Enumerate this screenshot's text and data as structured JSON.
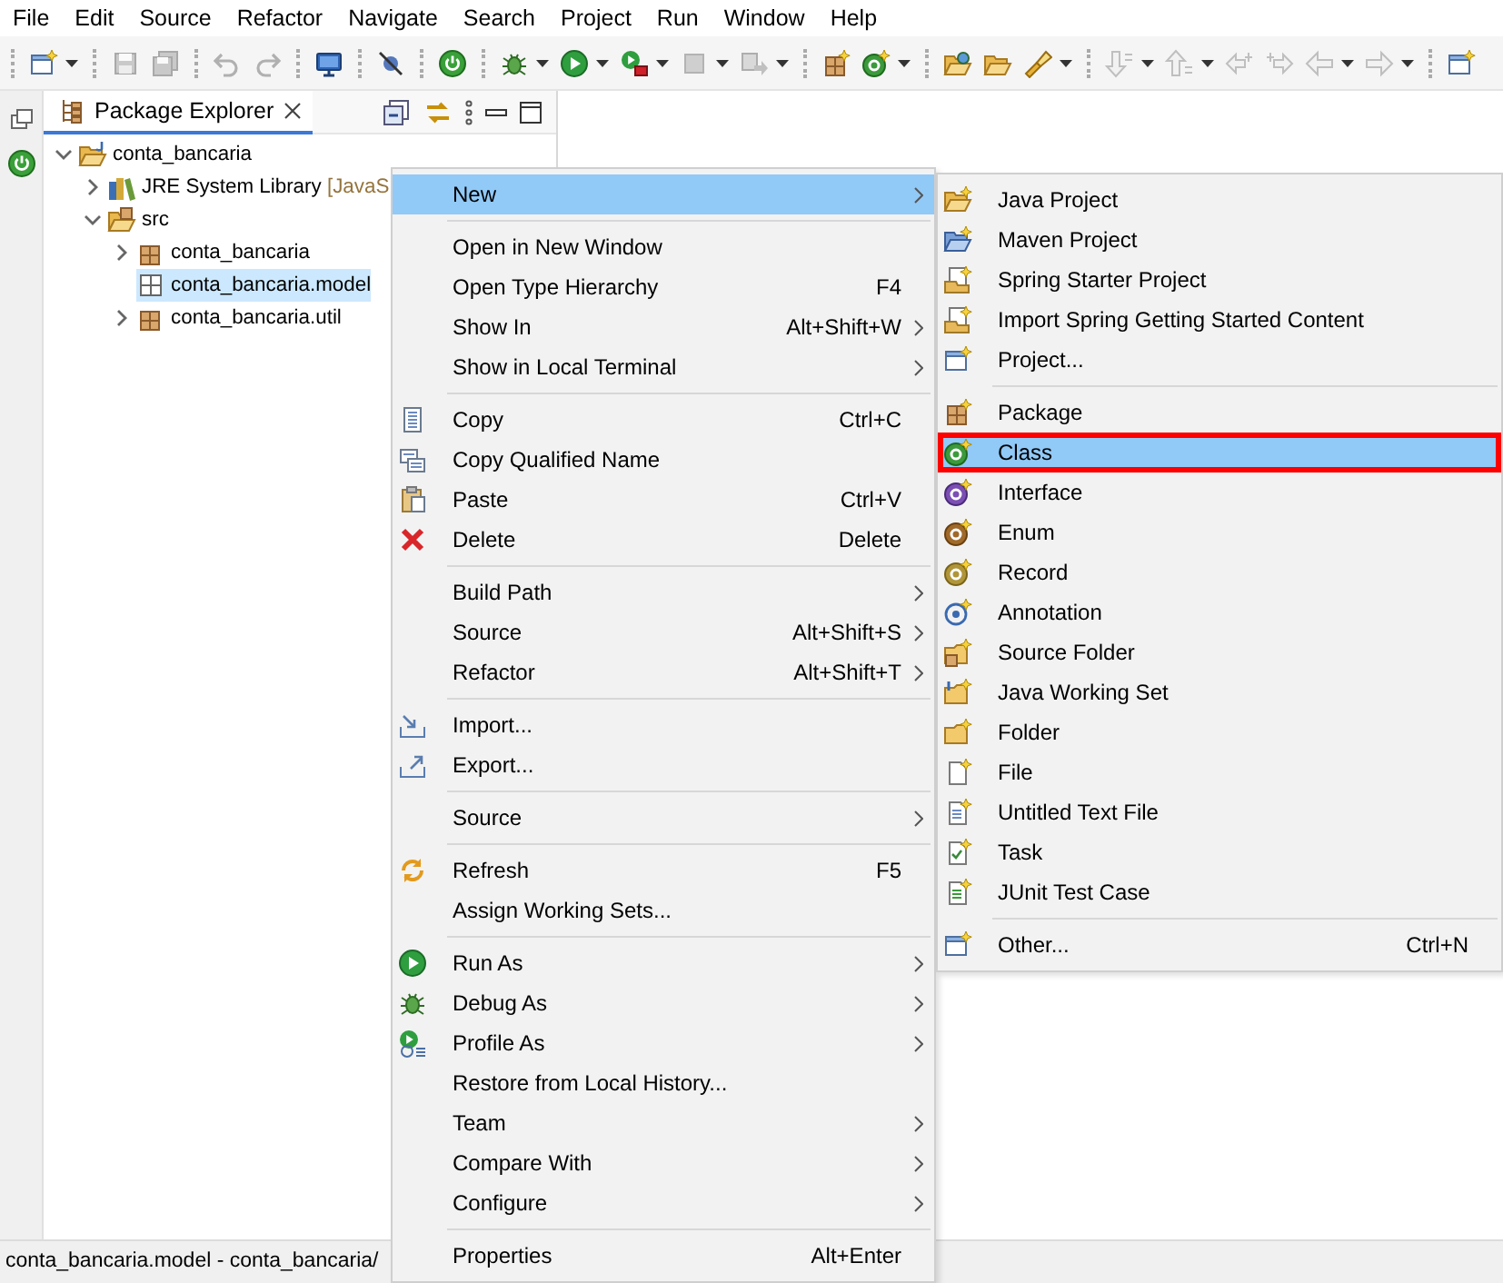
{
  "menu_bar": [
    "File",
    "Edit",
    "Source",
    "Refactor",
    "Navigate",
    "Search",
    "Project",
    "Run",
    "Window",
    "Help"
  ],
  "toolbar": [
    {
      "kind": "separator"
    },
    {
      "kind": "new",
      "dropdown": true,
      "disabled": false
    },
    {
      "kind": "separator"
    },
    {
      "kind": "save",
      "disabled": true
    },
    {
      "kind": "saveall",
      "disabled": true
    },
    {
      "kind": "separator"
    },
    {
      "kind": "undo",
      "disabled": true
    },
    {
      "kind": "redo",
      "disabled": true
    },
    {
      "kind": "separator"
    },
    {
      "kind": "terminal",
      "disabled": false
    },
    {
      "kind": "separator"
    },
    {
      "kind": "skipbp",
      "disabled": false
    },
    {
      "kind": "separator"
    },
    {
      "kind": "power",
      "disabled": false
    },
    {
      "kind": "separator"
    },
    {
      "kind": "bug",
      "dropdown": true,
      "disabled": false
    },
    {
      "kind": "run",
      "dropdown": true,
      "disabled": false
    },
    {
      "kind": "tool",
      "dropdown": true,
      "disabled": false
    },
    {
      "kind": "stop",
      "dropdown": true,
      "disabled": true
    },
    {
      "kind": "step",
      "dropdown": true,
      "disabled": true
    },
    {
      "kind": "separator"
    },
    {
      "kind": "pkg",
      "disabled": false
    },
    {
      "kind": "class",
      "dropdown": true,
      "disabled": false
    },
    {
      "kind": "separator"
    },
    {
      "kind": "openfolder",
      "disabled": false
    },
    {
      "kind": "folder",
      "disabled": false
    },
    {
      "kind": "torch",
      "dropdown": true,
      "disabled": false
    },
    {
      "kind": "separator"
    },
    {
      "kind": "nextann",
      "dropdown": true,
      "disabled": true
    },
    {
      "kind": "prevann",
      "dropdown": true,
      "disabled": true
    },
    {
      "kind": "lastedit",
      "disabled": true
    },
    {
      "kind": "fwdedit",
      "disabled": true
    },
    {
      "kind": "back",
      "dropdown": true,
      "disabled": true
    },
    {
      "kind": "forward",
      "dropdown": true,
      "disabled": true
    },
    {
      "kind": "separator"
    },
    {
      "kind": "window",
      "disabled": false
    }
  ],
  "package_explorer": {
    "title": "Package Explorer",
    "tree": [
      {
        "label": "conta_bancaria",
        "kind": "project",
        "expanded": true,
        "selected": false,
        "children": [
          {
            "label": "JRE System Library",
            "decoration": "[JavaS",
            "kind": "library",
            "expanded": false,
            "selected": false
          },
          {
            "label": "src",
            "kind": "source-folder",
            "expanded": true,
            "selected": false,
            "children": [
              {
                "label": "conta_bancaria",
                "kind": "package",
                "expanded": false,
                "selected": false
              },
              {
                "label": "conta_bancaria.model",
                "kind": "empty-package",
                "selected": true
              },
              {
                "label": "conta_bancaria.util",
                "kind": "package",
                "expanded": false,
                "selected": false
              }
            ]
          }
        ]
      }
    ]
  },
  "context_menu": {
    "items": [
      {
        "kind": "item",
        "label": "New",
        "submenu": true,
        "selected": true
      },
      {
        "kind": "separator"
      },
      {
        "kind": "item",
        "label": "Open in New Window",
        "submenu": false,
        "selected": false
      },
      {
        "kind": "item",
        "label": "Open Type Hierarchy",
        "shortcut": "F4",
        "submenu": false,
        "selected": false
      },
      {
        "kind": "item",
        "label": "Show In",
        "shortcut": "Alt+Shift+W",
        "submenu": true,
        "selected": false
      },
      {
        "kind": "item",
        "label": "Show in Local Terminal",
        "submenu": true,
        "selected": false
      },
      {
        "kind": "separator"
      },
      {
        "kind": "item",
        "label": "Copy",
        "shortcut": "Ctrl+C",
        "submenu": false,
        "selected": false
      },
      {
        "kind": "item",
        "label": "Copy Qualified Name",
        "submenu": false,
        "selected": false
      },
      {
        "kind": "item",
        "label": "Paste",
        "shortcut": "Ctrl+V",
        "submenu": false,
        "selected": false
      },
      {
        "kind": "item",
        "label": "Delete",
        "shortcut": "Delete",
        "submenu": false,
        "selected": false
      },
      {
        "kind": "separator"
      },
      {
        "kind": "item",
        "label": "Build Path",
        "submenu": true,
        "selected": false
      },
      {
        "kind": "item",
        "label": "Source",
        "shortcut": "Alt+Shift+S",
        "submenu": true,
        "selected": false
      },
      {
        "kind": "item",
        "label": "Refactor",
        "shortcut": "Alt+Shift+T",
        "submenu": true,
        "selected": false
      },
      {
        "kind": "separator"
      },
      {
        "kind": "item",
        "label": "Import...",
        "submenu": false,
        "selected": false
      },
      {
        "kind": "item",
        "label": "Export...",
        "submenu": false,
        "selected": false
      },
      {
        "kind": "separator"
      },
      {
        "kind": "item",
        "label": "Source",
        "submenu": true,
        "selected": false
      },
      {
        "kind": "separator"
      },
      {
        "kind": "item",
        "label": "Refresh",
        "shortcut": "F5",
        "submenu": false,
        "selected": false
      },
      {
        "kind": "item",
        "label": "Assign Working Sets...",
        "submenu": false,
        "selected": false
      },
      {
        "kind": "separator"
      },
      {
        "kind": "item",
        "label": "Run As",
        "submenu": true,
        "selected": false
      },
      {
        "kind": "item",
        "label": "Debug As",
        "submenu": true,
        "selected": false
      },
      {
        "kind": "item",
        "label": "Profile As",
        "submenu": true,
        "selected": false
      },
      {
        "kind": "item",
        "label": "Restore from Local History...",
        "submenu": false,
        "selected": false
      },
      {
        "kind": "item",
        "label": "Team",
        "submenu": true,
        "selected": false
      },
      {
        "kind": "item",
        "label": "Compare With",
        "submenu": true,
        "selected": false
      },
      {
        "kind": "item",
        "label": "Configure",
        "submenu": true,
        "selected": false
      },
      {
        "kind": "separator"
      },
      {
        "kind": "item",
        "label": "Properties",
        "shortcut": "Alt+Enter",
        "submenu": false,
        "selected": false
      }
    ]
  },
  "new_submenu": {
    "items": [
      {
        "kind": "item",
        "label": "Java Project",
        "selected": false,
        "outlined": false
      },
      {
        "kind": "item",
        "label": "Maven Project",
        "selected": false,
        "outlined": false
      },
      {
        "kind": "item",
        "label": "Spring Starter Project",
        "selected": false,
        "outlined": false
      },
      {
        "kind": "item",
        "label": "Import Spring Getting Started Content",
        "selected": false,
        "outlined": false
      },
      {
        "kind": "item",
        "label": "Project...",
        "selected": false,
        "outlined": false
      },
      {
        "kind": "separator"
      },
      {
        "kind": "item",
        "label": "Package",
        "selected": false,
        "outlined": false
      },
      {
        "kind": "item",
        "label": "Class",
        "selected": true,
        "outlined": true
      },
      {
        "kind": "item",
        "label": "Interface",
        "selected": false,
        "outlined": false
      },
      {
        "kind": "item",
        "label": "Enum",
        "selected": false,
        "outlined": false
      },
      {
        "kind": "item",
        "label": "Record",
        "selected": false,
        "outlined": false
      },
      {
        "kind": "item",
        "label": "Annotation",
        "selected": false,
        "outlined": false
      },
      {
        "kind": "item",
        "label": "Source Folder",
        "selected": false,
        "outlined": false
      },
      {
        "kind": "item",
        "label": "Java Working Set",
        "selected": false,
        "outlined": false
      },
      {
        "kind": "item",
        "label": "Folder",
        "selected": false,
        "outlined": false
      },
      {
        "kind": "item",
        "label": "File",
        "selected": false,
        "outlined": false
      },
      {
        "kind": "item",
        "label": "Untitled Text File",
        "selected": false,
        "outlined": false
      },
      {
        "kind": "item",
        "label": "Task",
        "selected": false,
        "outlined": false
      },
      {
        "kind": "item",
        "label": "JUnit Test Case",
        "selected": false,
        "outlined": false
      },
      {
        "kind": "separator"
      },
      {
        "kind": "item",
        "label": "Other...",
        "shortcut": "Ctrl+N",
        "selected": false,
        "outlined": false
      }
    ]
  },
  "status_bar": "conta_bancaria.model - conta_bancaria/"
}
